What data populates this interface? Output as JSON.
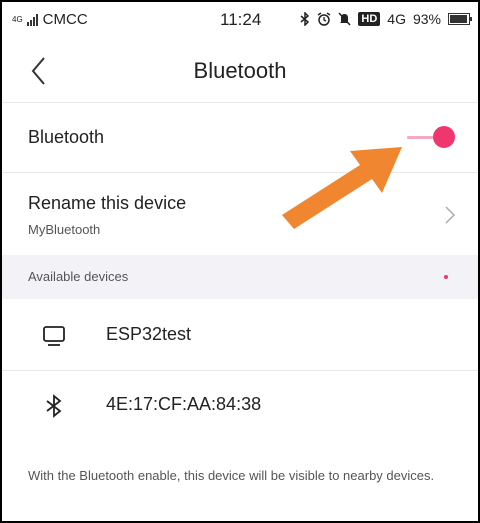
{
  "status_bar": {
    "signal": "4G",
    "carrier": "CMCC",
    "time": "11:24",
    "hd": "HD",
    "network": "4G",
    "battery": "93%"
  },
  "header": {
    "title": "Bluetooth",
    "back_icon": "chevron-left-icon"
  },
  "bluetooth_row": {
    "label": "Bluetooth",
    "enabled": true,
    "accent": "#f0366e"
  },
  "rename_row": {
    "label": "Rename this device",
    "value": "MyBluetooth"
  },
  "available_section": {
    "label": "Available devices"
  },
  "devices": [
    {
      "name": "ESP32test",
      "icon": "monitor-icon"
    },
    {
      "name": "4E:17:CF:AA:84:38",
      "icon": "bluetooth-icon"
    }
  ],
  "footer_text": "With the Bluetooth enable, this device will be visible to nearby devices.",
  "annotation": {
    "arrow_color": "#f0862f"
  }
}
